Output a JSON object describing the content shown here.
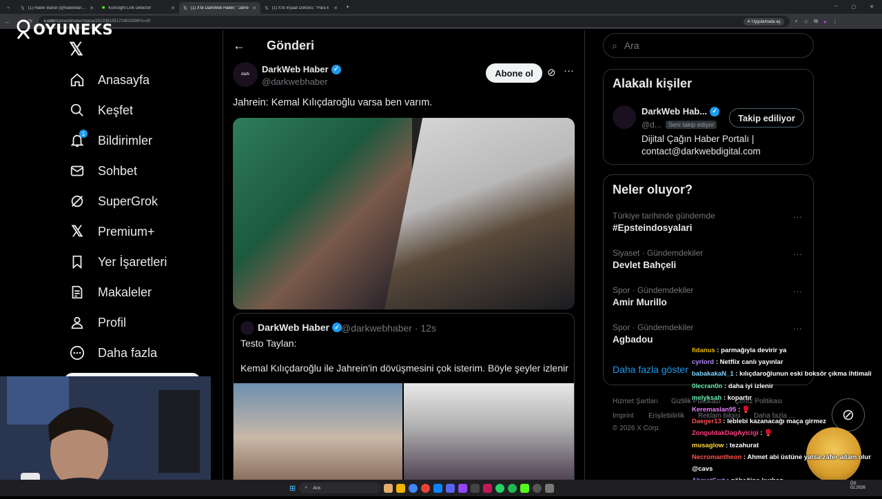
{
  "browser": {
    "tabs": [
      {
        "title": "(1) Haber Bandı (@haberbandi) /",
        "icon": "x-icon"
      },
      {
        "title": "KickSight Link Detector",
        "icon": "kick-icon"
      },
      {
        "title": "(1) X'te DarkWeb Haber: \"Jahre",
        "icon": "x-icon"
      },
      {
        "title": "(1) X'te İnşaat Doktoru: \"Para k",
        "icon": "x-icon"
      }
    ],
    "url_host": "x.com",
    "url_path": "/darkwebhaber/status/2019381351724810396?s=20",
    "open_in_app": "Uygulamada aç"
  },
  "overlay": {
    "logo_text": "OYUNEKS"
  },
  "sidebar": {
    "items": [
      {
        "label": "Anasayfa",
        "icon": "home-icon"
      },
      {
        "label": "Keşfet",
        "icon": "search-icon"
      },
      {
        "label": "Bildirimler",
        "icon": "bell-icon",
        "badge": "1"
      },
      {
        "label": "Sohbet",
        "icon": "mail-icon"
      },
      {
        "label": "SuperGrok",
        "icon": "grok-icon"
      },
      {
        "label": "Premium+",
        "icon": "x-icon"
      },
      {
        "label": "Yer İşaretleri",
        "icon": "bookmark-icon"
      },
      {
        "label": "Makaleler",
        "icon": "article-icon"
      },
      {
        "label": "Profil",
        "icon": "person-icon"
      },
      {
        "label": "Daha fazla",
        "icon": "more-circle-icon"
      }
    ]
  },
  "post": {
    "header_title": "Gönderi",
    "author_name": "DarkWeb Haber",
    "author_handle": "@darkwebhaber",
    "avatar_text": "dark",
    "subscribe_label": "Abone ol",
    "text": "Jahrein: Kemal Kılıçdaroğlu varsa ben varım.",
    "quote": {
      "author_name": "DarkWeb Haber",
      "handle_time": "@darkwebhaber · 12s",
      "line1": "Testo Taylan:",
      "line2": "Kemal Kılıçdaroğlu ile Jahrein'in dövüşmesini çok isterim. Böyle şeyler izlenir"
    }
  },
  "right": {
    "search_placeholder": "Ara",
    "related": {
      "title": "Alakalı kişiler",
      "name": "DarkWeb Hab...",
      "handle": "@d...",
      "follows_you": "Seni takip ediyor",
      "follow_label": "Takip ediliyor",
      "bio1": "Dijital Çağın Haber Portalı |",
      "bio2": "contact@darkwebdigital.com"
    },
    "trends": {
      "title": "Neler oluyor?",
      "items": [
        {
          "meta": "Türkiye tarihinde gündemde",
          "name": "#Epsteindosyalari"
        },
        {
          "meta": "Siyaset · Gündemdekiler",
          "name": "Devlet Bahçeli"
        },
        {
          "meta": "Spor · Gündemdekiler",
          "name": "Amir Murillo"
        },
        {
          "meta": "Spor · Gündemdekiler",
          "name": "Agbadou"
        }
      ],
      "show_more": "Daha fazla göster"
    },
    "footer": {
      "row1": [
        "Hizmet Şartları",
        "Gizlilik Politikası",
        "Çerez Politikası"
      ],
      "row2": [
        "Imprint",
        "Erişilebilirlik",
        "Reklam bilgisi",
        "Daha fazla ..."
      ],
      "copyright": "© 2026 X Corp."
    }
  },
  "chat": [
    {
      "user": "fidanus",
      "color": "#e6b800",
      "text": ": parmağıyla devirir ya"
    },
    {
      "user": "cyrlord",
      "color": "#b388ff",
      "text": ": Netflix canlı yayınlar"
    },
    {
      "user": "babakakaN_1",
      "color": "#80d8ff",
      "text": ": kılıçdaroğlunun eski boksör çıkma ihtimali"
    },
    {
      "user": "0lecran0n",
      "color": "#69f0ae",
      "text": ": daha iyi izlenir"
    },
    {
      "user": "melyksah",
      "color": "#69f0ae",
      "text": ": kopartır"
    },
    {
      "user": "Keremaslan95",
      "color": "#ea80fc",
      "text": ": 🥊"
    },
    {
      "user": "Daeger13",
      "color": "#ff5252",
      "text": ": leblebi kazanacağı maça girmez"
    },
    {
      "user": "ZonguldakDagAyicigi",
      "color": "#ff4081",
      "text": ": 🥊"
    },
    {
      "user": "musaglow",
      "color": "#ffd740",
      "text": ": tezahurat"
    },
    {
      "user": "Necromantheon",
      "color": "#ff5252",
      "text": ": Ahmet abi üstüne yatsa zafer adam olur"
    },
    {
      "user": "",
      "color": "#ffffff",
      "text": "@cavs"
    },
    {
      "user": "AhmetSert",
      "color": "#b388ff",
      "text": ": göbeğine kurban"
    },
    {
      "user": "",
      "color": "#ffffff",
      "text": "yardıma"
    }
  ],
  "taskbar": {
    "search_placeholder": "Ara",
    "clock_line1": "ÖS",
    "clock_line2": "02.2026"
  }
}
